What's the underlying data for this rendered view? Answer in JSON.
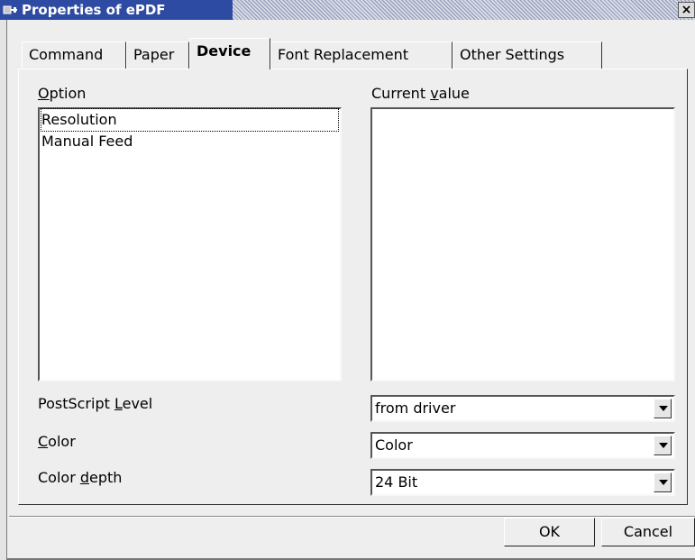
{
  "window": {
    "title": "Properties of ePDF",
    "close_label": "×"
  },
  "tabs": [
    {
      "label": "Command",
      "active": false
    },
    {
      "label": "Paper",
      "active": false
    },
    {
      "label": "Device",
      "active": true
    },
    {
      "label": "Font Replacement",
      "active": false
    },
    {
      "label": "Other Settings",
      "active": false
    }
  ],
  "device": {
    "option_label_prefix": "",
    "option_label_mnemonic": "O",
    "option_label_rest": "ption",
    "current_value_label_prefix": "Current ",
    "current_value_label_mnemonic": "v",
    "current_value_label_rest": "alue",
    "options": [
      "Resolution",
      "Manual Feed"
    ],
    "postscript_level": {
      "prefix": "PostScript ",
      "mnemonic": "L",
      "rest": "evel",
      "value": "from driver"
    },
    "color": {
      "prefix": "",
      "mnemonic": "C",
      "rest": "olor",
      "value": "Color"
    },
    "color_depth": {
      "prefix": "Color ",
      "mnemonic": "d",
      "rest": "epth",
      "value": "24 Bit"
    }
  },
  "buttons": {
    "ok": "OK",
    "cancel": "Cancel"
  },
  "icons": {
    "system_menu": "window-menu-icon",
    "close": "close-icon",
    "dropdown": "chevron-down-icon"
  }
}
